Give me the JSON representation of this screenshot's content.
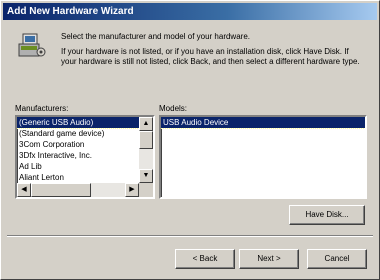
{
  "window": {
    "title": "Add New Hardware Wizard"
  },
  "header": {
    "intro_primary": "Select the manufacturer and model of your hardware.",
    "intro_secondary": "If your hardware is not listed, or if you have an installation disk, click Have Disk. If your hardware is still not listed, click Back, and then select a different hardware type."
  },
  "manufacturers": {
    "label": "Manufacturers:",
    "items": [
      "(Generic USB Audio)",
      "(Standard game device)",
      "3Com Corporation",
      "3Dfx Interactive, Inc.",
      "Ad Lib",
      "Aliant Lerton"
    ],
    "selected_index": 0
  },
  "models": {
    "label": "Models:",
    "items": [
      "USB Audio Device"
    ],
    "selected_index": 0
  },
  "buttons": {
    "have_disk": "Have Disk...",
    "back": "< Back",
    "next": "Next >",
    "cancel": "Cancel"
  },
  "icons": {
    "hardware": "hardware-wizard-icon"
  }
}
